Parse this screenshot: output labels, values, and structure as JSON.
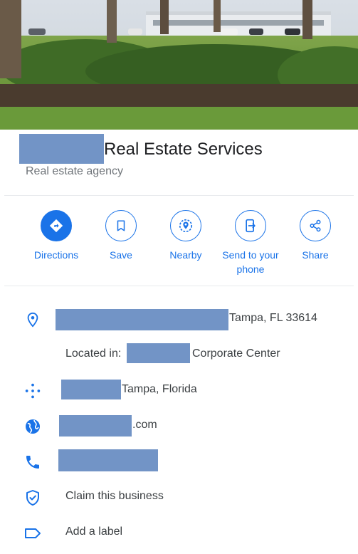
{
  "place": {
    "name_suffix": "Real Estate Services",
    "category": "Real estate agency"
  },
  "actions": [
    {
      "label": "Directions",
      "icon": "directions-icon"
    },
    {
      "label": "Save",
      "icon": "bookmark-icon"
    },
    {
      "label": "Nearby",
      "icon": "nearby-icon"
    },
    {
      "label": "Send to your phone",
      "icon": "send-to-phone-icon"
    },
    {
      "label": "Share",
      "icon": "share-icon"
    }
  ],
  "details": {
    "address_suffix": "Tampa, FL 33614",
    "located_in_prefix": "Located in:",
    "located_in_suffix": "Corporate Center",
    "plus_code_suffix": "Tampa, Florida",
    "website_suffix": ".com",
    "claim_label": "Claim this business",
    "add_label": "Add a label"
  },
  "colors": {
    "accent": "#1a73e8",
    "redaction": "#7294c6"
  }
}
